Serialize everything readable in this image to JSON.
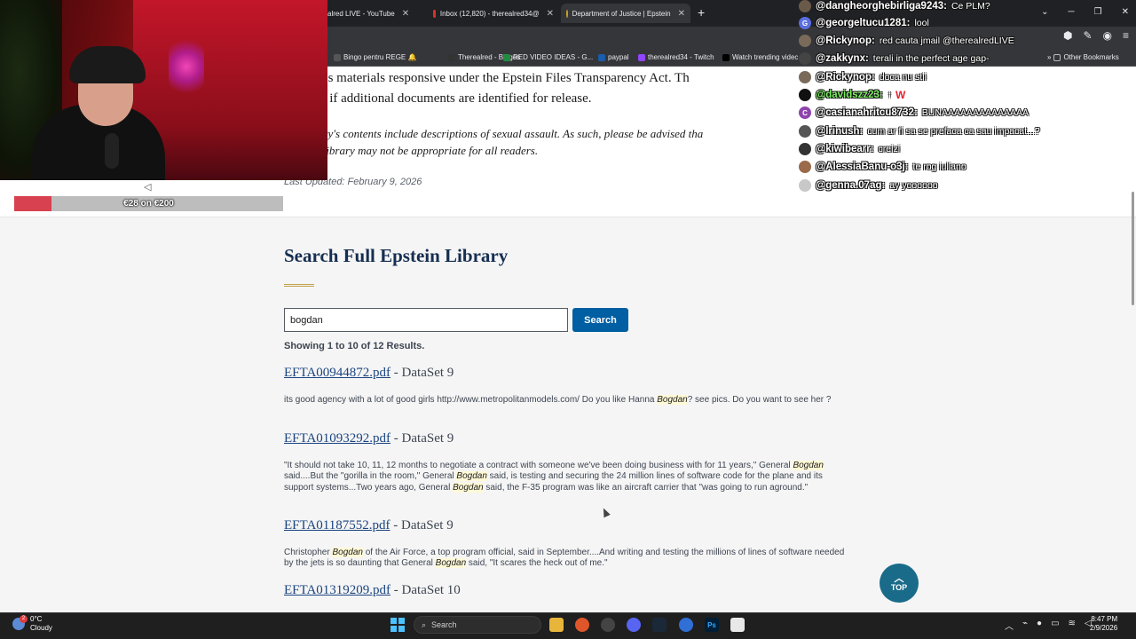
{
  "browser": {
    "tabs": [
      {
        "label": "alred LIVE - YouTube",
        "favicon_color": "#ff0000"
      },
      {
        "label": "Inbox (12,820) - therealred34@",
        "favicon_color": "#d93025"
      },
      {
        "label": "Department of Justice | Epstein",
        "favicon_color": "#c9a227",
        "active": true
      }
    ],
    "new_tab_symbol": "+",
    "bookmarks": [
      {
        "label": "Bingo pentru REGE 🔔",
        "color": "#444"
      },
      {
        "label": "Therealred - Bingos",
        "color": "#333"
      },
      {
        "label": "RED VIDEO IDEAS - G...",
        "color": "#1e8e3e"
      },
      {
        "label": "paypal",
        "color": "#003087"
      },
      {
        "label": "therealred34 - Twitch",
        "color": "#9146ff"
      },
      {
        "label": "Watch trending videc",
        "color": "#000"
      }
    ],
    "other_bookmarks": "Other Bookmarks"
  },
  "intro": {
    "line1": "te houses materials responsive under the Epstein Files Transparency Act. Th",
    "line2": "updated if additional documents are identified for release.",
    "warning1": "the library's contents include descriptions of sexual assault. As such, please be advised tha",
    "warning2": "s of this library may not be appropriate for all readers.",
    "last_updated": "Last Updated: February 9, 2026"
  },
  "search": {
    "title": "Search Full Epstein Library",
    "query": "bogdan",
    "button_label": "Search",
    "results_summary": "Showing 1 to 10 of 12 Results."
  },
  "results": [
    {
      "file": "EFTA00944872.pdf",
      "dataset": " - DataSet 9",
      "snippet": [
        {
          "t": "its good agency with a lot of good girls http://www.metropolitanmodels.com/ Do you like Hanna "
        },
        {
          "t": "Bogdan",
          "hl": true
        },
        {
          "t": "? see pics. Do you want to see her ?"
        }
      ]
    },
    {
      "file": "EFTA01093292.pdf",
      "dataset": " - DataSet 9",
      "snippet": [
        {
          "t": "\"It should not take 10, 11, 12 months to negotiate a contract with someone we've been doing business with for 11 years,\" General "
        },
        {
          "t": "Bogdan",
          "hl": true
        },
        {
          "t": " said....But the \"gorilla in the room,\" General "
        },
        {
          "t": "Bogdan",
          "hl": true
        },
        {
          "t": " said, is testing and securing the 24 million lines of software code for the plane and its support systems...Two years ago, General "
        },
        {
          "t": "Bogdan",
          "hl": true
        },
        {
          "t": " said, the F-35 program was like an aircraft carrier that \"was going to run aground.\""
        }
      ]
    },
    {
      "file": "EFTA01187552.pdf",
      "dataset": " - DataSet 9",
      "snippet": [
        {
          "t": "Christopher "
        },
        {
          "t": "Bogdan",
          "hl": true
        },
        {
          "t": " of the Air Force, a top program official, said in September....And writing and testing the millions of lines of software needed by the jets is so daunting that General "
        },
        {
          "t": "Bogdan",
          "hl": true
        },
        {
          "t": " said, \"It scares the heck out of me.\""
        }
      ]
    },
    {
      "file": "EFTA01319209.pdf",
      "dataset": " - DataSet 10",
      "snippet": []
    }
  ],
  "top_button": {
    "arrow": "︿",
    "label": "TOP"
  },
  "donation": {
    "text": "€28 on €200",
    "progress": 0.14,
    "icon": "◁"
  },
  "chat": [
    {
      "user": "@dangheorghebirliga9243:",
      "text": "Ce PLM?",
      "avatar": "#6a5a4a"
    },
    {
      "user": "@georgeltucu1281:",
      "text": "lool",
      "avatar": "#5b6ee1",
      "initial": "G"
    },
    {
      "user": "@Rickynop:",
      "text": "red cauta jmail @therealredLIVE",
      "avatar": "#7a6a5a"
    },
    {
      "user": "@zakkynx:",
      "text": "terali in the perfect age gap-",
      "avatar": "#444"
    },
    {
      "user": "@Rickynop:",
      "text": "doca nu stii",
      "avatar": "#7a6a5a"
    },
    {
      "user": "@davidszz23:",
      "text": "↑",
      "avatar": "#111",
      "green": true,
      "badge": "W"
    },
    {
      "user": "@casianahritcu8732:",
      "text": "BUNAAAAAAAAAAAAAA",
      "avatar": "#8e44ad",
      "initial": "C"
    },
    {
      "user": "@lrinush:",
      "text": "cum ar fi sa se prefaca ca sau impacat...?",
      "avatar": "#555"
    },
    {
      "user": "@kiwibearr:",
      "text": "creizi",
      "avatar": "#333"
    },
    {
      "user": "@AlessiaBanu-o3j:",
      "text": "te rog iuliano",
      "avatar": "#9a6a4a"
    },
    {
      "user": "@genna.07ag:",
      "text": "ay yoooooo",
      "avatar": "#c8c8c8"
    }
  ],
  "taskbar": {
    "weather_temp": "0°C",
    "weather_desc": "Cloudy",
    "weather_badge": "2",
    "search_label": "Search",
    "time": "8:47 PM",
    "date": "2/9/2026"
  }
}
